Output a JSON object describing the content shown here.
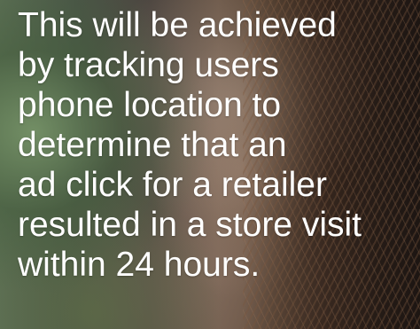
{
  "slide": {
    "caption": "This will be achieved\nby tracking users\nphone location to\ndetermine that an\nad click for a retailer\nresulted in a store visit\nwithin 24 hours."
  },
  "background": {
    "description_colors": [
      "#5c6f55",
      "#6b5748",
      "#3e2b20"
    ]
  }
}
